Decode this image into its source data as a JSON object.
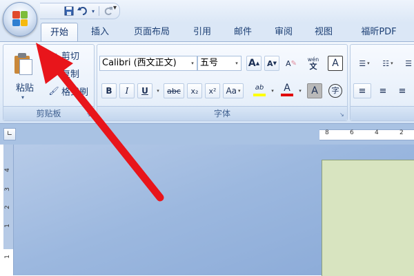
{
  "quick_access": {
    "save_icon": "save-icon",
    "undo_icon": "undo-icon",
    "redo_icon": "redo-icon",
    "customize_icon": "customize-arrow-icon"
  },
  "tabs": [
    {
      "label": "开始",
      "active": true
    },
    {
      "label": "插入"
    },
    {
      "label": "页面布局"
    },
    {
      "label": "引用"
    },
    {
      "label": "邮件"
    },
    {
      "label": "审阅"
    },
    {
      "label": "视图"
    },
    {
      "label": "福昕PDF"
    }
  ],
  "clipboard": {
    "paste": "粘贴",
    "cut": "剪切",
    "copy": "复制",
    "format_painter": "格式刷",
    "group_label": "剪贴板"
  },
  "font": {
    "font_name": "Calibri (西文正文)",
    "font_size": "五号",
    "group_label": "字体",
    "bold": "B",
    "italic": "I",
    "underline": "U",
    "strikethrough": "abc",
    "subscript": "x₂",
    "superscript": "x²",
    "change_case": "Aa",
    "grow": "A",
    "shrink": "A",
    "clear_format": "A",
    "phonetic": "wén",
    "char_border": "A",
    "highlight": "ab",
    "font_color": "A",
    "char_shading": "A",
    "enclose_char": "字"
  },
  "ruler": {
    "h_labels": [
      "8",
      "6",
      "4",
      "2"
    ],
    "v_labels": [
      "4",
      "3",
      "2",
      "1",
      "1"
    ]
  },
  "colors": {
    "accent": "#15428b",
    "highlight_yellow": "#ffff00",
    "font_red": "#e00000",
    "arrow_red": "#e8151b",
    "page_background": "#d8e4c0"
  }
}
